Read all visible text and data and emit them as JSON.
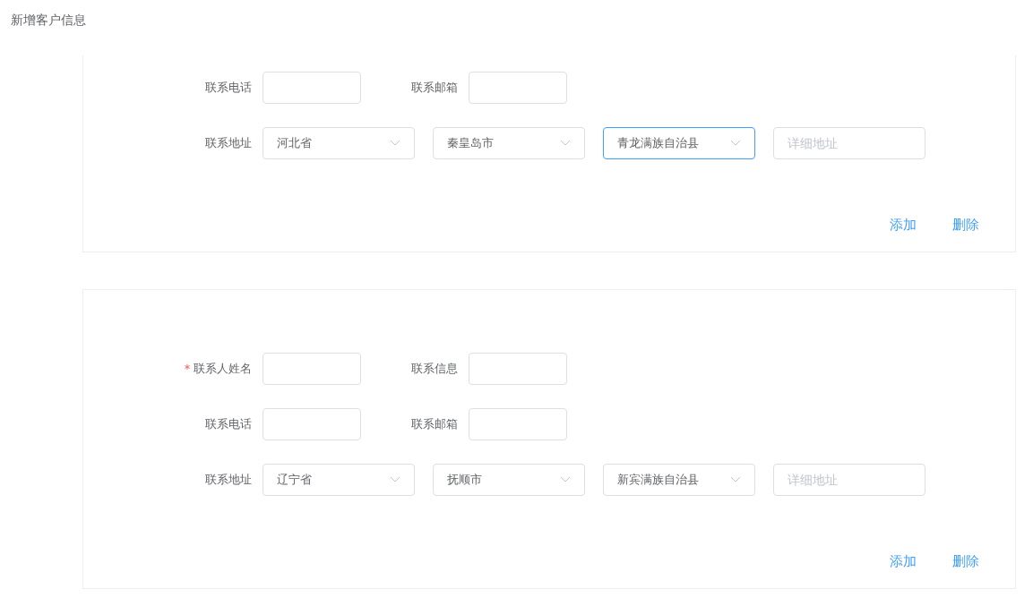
{
  "page_title": "新增客户信息",
  "cards": [
    {
      "rows": [
        {
          "fields": [
            {
              "kind": "input",
              "label": "联系电话",
              "required": false
            },
            {
              "kind": "input",
              "label": "联系邮箱",
              "required": false
            }
          ]
        },
        {
          "fields": [
            {
              "kind": "select",
              "label": "联系地址",
              "required": false,
              "value": "河北省",
              "focused": false
            },
            {
              "kind": "select",
              "value": "秦皇岛市",
              "focused": false
            },
            {
              "kind": "select",
              "value": "青龙满族自治县",
              "focused": true
            },
            {
              "kind": "input",
              "placeholder": "详细地址"
            }
          ]
        }
      ],
      "actions": [
        "添加",
        "删除"
      ]
    },
    {
      "rows": [
        {
          "fields": [
            {
              "kind": "input",
              "label": "联系人姓名",
              "required": true
            },
            {
              "kind": "input",
              "label": "联系信息",
              "required": false
            }
          ]
        },
        {
          "fields": [
            {
              "kind": "input",
              "label": "联系电话",
              "required": false
            },
            {
              "kind": "input",
              "label": "联系邮箱",
              "required": false
            }
          ]
        },
        {
          "fields": [
            {
              "kind": "select",
              "label": "联系地址",
              "required": false,
              "value": "辽宁省",
              "focused": false
            },
            {
              "kind": "select",
              "value": "抚顺市",
              "focused": false
            },
            {
              "kind": "select",
              "value": "新宾满族自治县",
              "focused": false
            },
            {
              "kind": "input",
              "placeholder": "详细地址"
            }
          ]
        }
      ],
      "actions": [
        "添加",
        "删除"
      ]
    }
  ]
}
